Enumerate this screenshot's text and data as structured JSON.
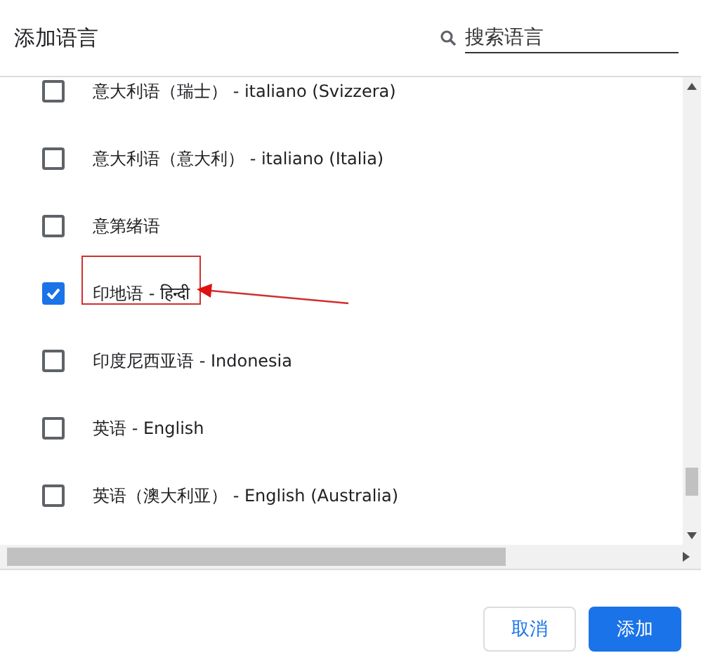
{
  "dialog": {
    "title": "添加语言"
  },
  "search": {
    "placeholder": "搜索语言"
  },
  "languages": [
    {
      "label": "意大利语（瑞士） - italiano (Svizzera)",
      "checked": false
    },
    {
      "label": "意大利语（意大利） - italiano (Italia)",
      "checked": false
    },
    {
      "label": "意第绪语",
      "checked": false
    },
    {
      "label": "印地语 - हिन्दी",
      "checked": true
    },
    {
      "label": "印度尼西亚语 - Indonesia",
      "checked": false
    },
    {
      "label": "英语 - English",
      "checked": false
    },
    {
      "label": "英语（澳大利亚） - English (Australia)",
      "checked": false
    }
  ],
  "buttons": [
    {
      "label": "取消",
      "kind": "secondary"
    },
    {
      "label": "添加",
      "kind": "primary"
    }
  ]
}
